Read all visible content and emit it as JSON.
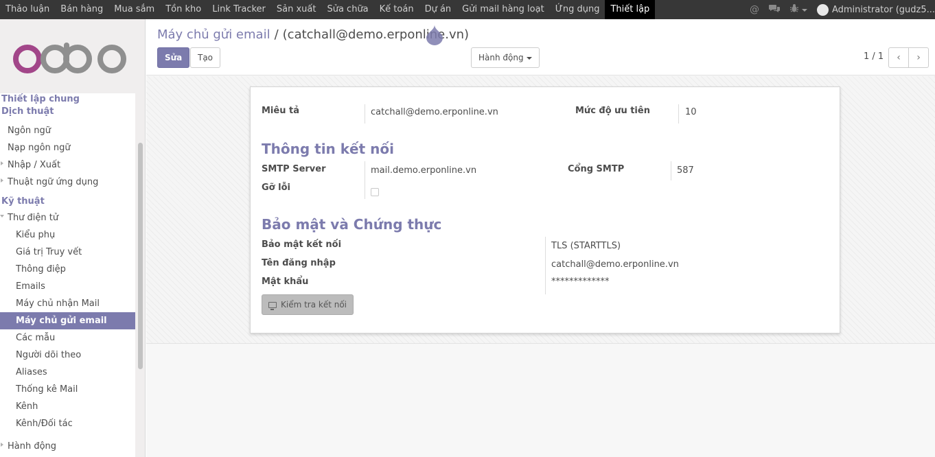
{
  "topnav": {
    "items": [
      "Thảo luận",
      "Bán hàng",
      "Mua sắm",
      "Tồn kho",
      "Link Tracker",
      "Sản xuất",
      "Sửa chữa",
      "Kế toán",
      "Dự án",
      "Gửi mail hàng loạt",
      "Ứng dụng",
      "Thiết lập"
    ],
    "active": "Thiết lập",
    "user_label": "Administrator (gudz5..."
  },
  "sidebar": {
    "logo_text": "odoo",
    "items": [
      {
        "label": "Thiết lập chung",
        "level": "header"
      },
      {
        "label": "Dịch thuật",
        "level": "header"
      },
      {
        "label": "Ngôn ngữ",
        "level": "l1"
      },
      {
        "label": "Nạp ngôn ngữ",
        "level": "l1"
      },
      {
        "label": "Nhập / Xuất",
        "level": "l1",
        "toggle": "collapsed"
      },
      {
        "label": "Thuật ngữ ứng dụng",
        "level": "l1",
        "toggle": "collapsed"
      },
      {
        "label": "Kỹ thuật",
        "level": "header"
      },
      {
        "label": "Thư điện tử",
        "level": "l1",
        "toggle": "expanded"
      },
      {
        "label": "Kiểu phụ",
        "level": "l2"
      },
      {
        "label": "Giá trị Truy vết",
        "level": "l2"
      },
      {
        "label": "Thông điệp",
        "level": "l2"
      },
      {
        "label": "Emails",
        "level": "l2"
      },
      {
        "label": "Máy chủ nhận Mail",
        "level": "l2"
      },
      {
        "label": "Máy chủ gửi email",
        "level": "l2",
        "selected": true
      },
      {
        "label": "Các mẫu",
        "level": "l2"
      },
      {
        "label": "Người dõi theo",
        "level": "l2"
      },
      {
        "label": "Aliases",
        "level": "l2"
      },
      {
        "label": "Thống kê Mail",
        "level": "l2"
      },
      {
        "label": "Kênh",
        "level": "l2"
      },
      {
        "label": "Kênh/Đối tác",
        "level": "l2"
      },
      {
        "label": "Hành động",
        "level": "l1",
        "toggle": "collapsed"
      }
    ]
  },
  "breadcrumb": {
    "parent": "Máy chủ gửi email",
    "separator": "/",
    "current": "(catchall@demo.erponline.vn)"
  },
  "buttons": {
    "edit": "Sửa",
    "create": "Tạo",
    "action": "Hành động"
  },
  "pager": {
    "value": "1 / 1"
  },
  "form": {
    "description_label": "Miêu tả",
    "description_value": "catchall@demo.erponline.vn",
    "priority_label": "Mức độ ưu tiên",
    "priority_value": "10",
    "section_connection": "Thông tin kết nối",
    "smtp_server_label": "SMTP Server",
    "smtp_server_value": "mail.demo.erponline.vn",
    "smtp_port_label": "Cổng SMTP",
    "smtp_port_value": "587",
    "debug_label": "Gỡ lỗi",
    "debug_checked": false,
    "section_security": "Bảo mật và Chứng thực",
    "conn_security_label": "Bảo mật kết nối",
    "conn_security_value": "TLS (STARTTLS)",
    "username_label": "Tên đăng nhập",
    "username_value": "catchall@demo.erponline.vn",
    "password_label": "Mật khẩu",
    "password_value": "*************",
    "test_button": "Kiểm tra kết nối"
  },
  "colors": {
    "accent": "#7c7bad",
    "topbar": "#373737"
  }
}
